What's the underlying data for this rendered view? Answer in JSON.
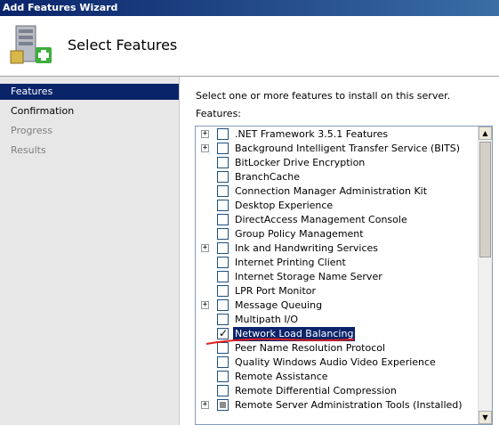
{
  "window": {
    "title": "Add Features Wizard"
  },
  "header": {
    "title": "Select Features",
    "icon": "server-add-icon"
  },
  "nav": {
    "items": [
      {
        "label": "Features",
        "state": "selected"
      },
      {
        "label": "Confirmation",
        "state": "normal"
      },
      {
        "label": "Progress",
        "state": "disabled"
      },
      {
        "label": "Results",
        "state": "disabled"
      }
    ]
  },
  "main": {
    "instruction": "Select one or more features to install on this server.",
    "features_label": "Features:",
    "features": [
      {
        "label": ".NET Framework 3.5.1 Features",
        "expandable": true,
        "checked": "none"
      },
      {
        "label": "Background Intelligent Transfer Service (BITS)",
        "expandable": true,
        "checked": "none"
      },
      {
        "label": "BitLocker Drive Encryption",
        "expandable": false,
        "checked": "none"
      },
      {
        "label": "BranchCache",
        "expandable": false,
        "checked": "none"
      },
      {
        "label": "Connection Manager Administration Kit",
        "expandable": false,
        "checked": "none"
      },
      {
        "label": "Desktop Experience",
        "expandable": false,
        "checked": "none"
      },
      {
        "label": "DirectAccess Management Console",
        "expandable": false,
        "checked": "none"
      },
      {
        "label": "Group Policy Management",
        "expandable": false,
        "checked": "none"
      },
      {
        "label": "Ink and Handwriting Services",
        "expandable": true,
        "checked": "none"
      },
      {
        "label": "Internet Printing Client",
        "expandable": false,
        "checked": "none"
      },
      {
        "label": "Internet Storage Name Server",
        "expandable": false,
        "checked": "none"
      },
      {
        "label": "LPR Port Monitor",
        "expandable": false,
        "checked": "none"
      },
      {
        "label": "Message Queuing",
        "expandable": true,
        "checked": "none"
      },
      {
        "label": "Multipath I/O",
        "expandable": false,
        "checked": "none"
      },
      {
        "label": "Network Load Balancing",
        "expandable": false,
        "checked": "checked",
        "selected": true
      },
      {
        "label": "Peer Name Resolution Protocol",
        "expandable": false,
        "checked": "none"
      },
      {
        "label": "Quality Windows Audio Video Experience",
        "expandable": false,
        "checked": "none"
      },
      {
        "label": "Remote Assistance",
        "expandable": false,
        "checked": "none"
      },
      {
        "label": "Remote Differential Compression",
        "expandable": false,
        "checked": "none"
      },
      {
        "label": "Remote Server Administration Tools  (Installed)",
        "expandable": true,
        "checked": "partial"
      }
    ]
  },
  "colors": {
    "selection": "#0a246a",
    "annotation": "#e02020"
  }
}
